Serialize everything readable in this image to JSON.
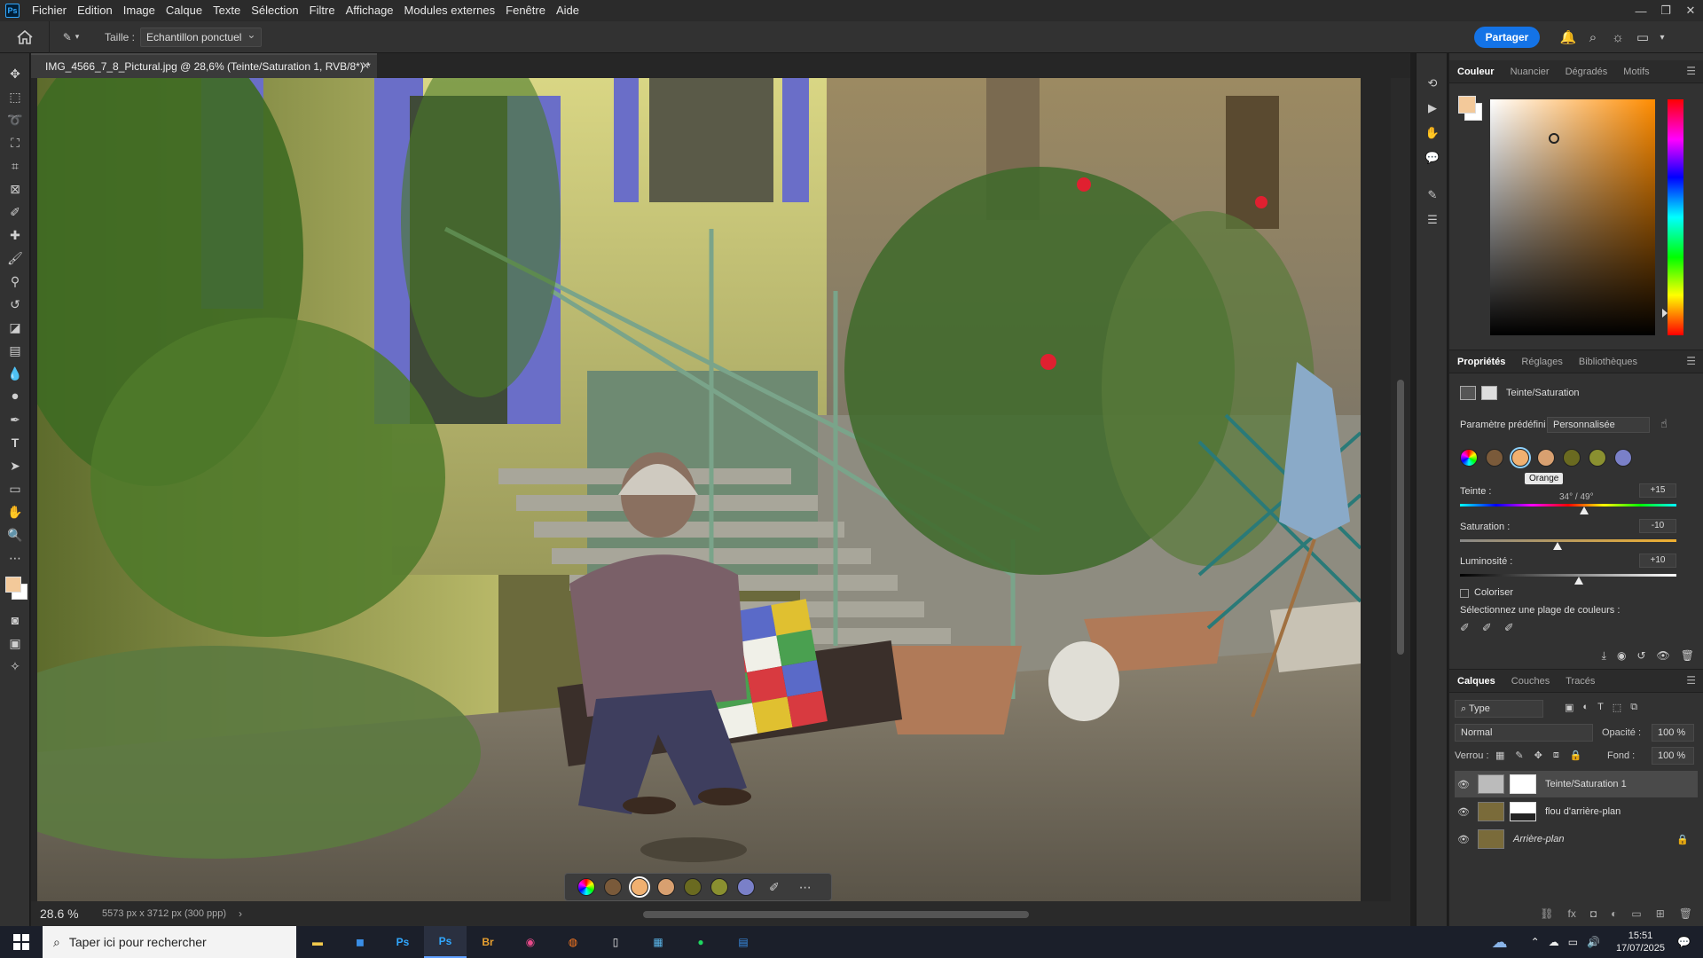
{
  "menubar": {
    "logo": "Ps",
    "items": [
      "Fichier",
      "Edition",
      "Image",
      "Calque",
      "Texte",
      "Sélection",
      "Filtre",
      "Affichage",
      "Modules externes",
      "Fenêtre",
      "Aide"
    ]
  },
  "optionsbar": {
    "size_label": "Taille :",
    "size_value": "Echantillon ponctuel",
    "share_label": "Partager"
  },
  "document": {
    "tab_title": "IMG_4566_7_8_Pictural.jpg @ 28,6% (Teinte/Saturation 1, RVB/8*) *",
    "zoom": "28.6 %",
    "dimensions": "5573 px x 3712 px (300 ppp)"
  },
  "color_panel": {
    "tabs": [
      "Couleur",
      "Nuancier",
      "Dégradés",
      "Motifs"
    ],
    "foreground": "#f3c99a",
    "background": "#ffffff"
  },
  "properties_panel": {
    "tabs": [
      "Propriétés",
      "Réglages",
      "Bibliothèques"
    ],
    "adjustment_name": "Teinte/Saturation",
    "preset_label": "Paramètre prédéfini :",
    "preset_value": "Personnalisée",
    "tooltip": "Orange",
    "hue_label": "Teinte :",
    "hue_value": "+15",
    "range_text": "34° / 49°",
    "saturation_label": "Saturation :",
    "saturation_value": "-10",
    "lightness_label": "Luminosité :",
    "lightness_value": "+10",
    "colorize_label": "Coloriser",
    "range_select_label": "Sélectionnez une plage de couleurs :",
    "swatches": [
      "#e0a070",
      "#7a5a3a",
      "#f0b070",
      "#d8a070",
      "#6a6a20",
      "#8a9030",
      "#7a80c8"
    ]
  },
  "layers_panel": {
    "tabs": [
      "Calques",
      "Couches",
      "Tracés"
    ],
    "filter_label": "Type",
    "blend_mode": "Normal",
    "opacity_label": "Opacité :",
    "opacity_value": "100 %",
    "lock_label": "Verrou :",
    "fill_label": "Fond :",
    "fill_value": "100 %",
    "layers": [
      {
        "name": "Teinte/Saturation 1"
      },
      {
        "name": "flou d'arrière-plan"
      },
      {
        "name": "Arrière-plan"
      }
    ]
  },
  "taskbar": {
    "search_placeholder": "Taper ici pour rechercher",
    "time": "15:51",
    "date": "17/07/2025"
  }
}
